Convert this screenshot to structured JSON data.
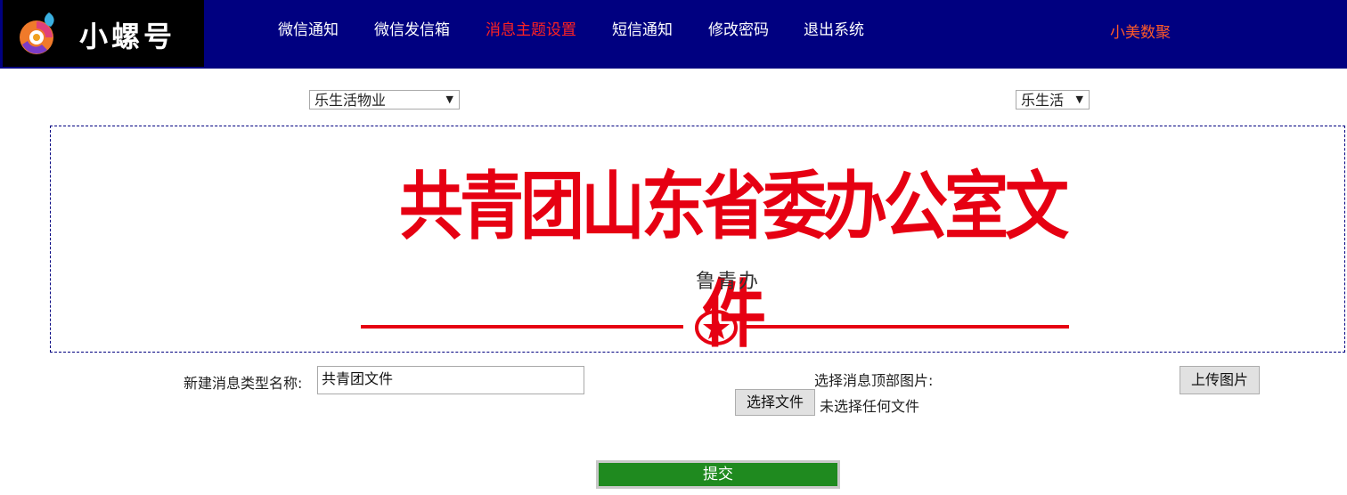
{
  "header": {
    "logo_text": "小螺号",
    "nav": [
      {
        "label": "微信通知"
      },
      {
        "label": "微信发信箱"
      },
      {
        "label": "消息主题设置"
      },
      {
        "label": "短信通知"
      },
      {
        "label": "修改密码"
      },
      {
        "label": "退出系统"
      }
    ],
    "active_nav": "消息主题设置",
    "brand": "小美数聚"
  },
  "filters": {
    "org_select": "乐生活物业",
    "app_select": "乐生活"
  },
  "banner": {
    "title": "共青团山东省委办公室文件",
    "subtitle": "鲁青办",
    "icon": "star-emblem-icon"
  },
  "form": {
    "type_name_label": "新建消息类型名称:",
    "type_name_value": "共青团文件",
    "image_label": "选择消息顶部图片:",
    "choose_file_button": "选择文件",
    "no_file_text": "未选择任何文件",
    "upload_button": "上传图片",
    "submit_button": "提交"
  },
  "colors": {
    "topbar": "#000080",
    "active_nav": "#ff2222",
    "brand": "#ff5a28",
    "banner_red": "#e60012",
    "submit": "#1f8a1f"
  }
}
